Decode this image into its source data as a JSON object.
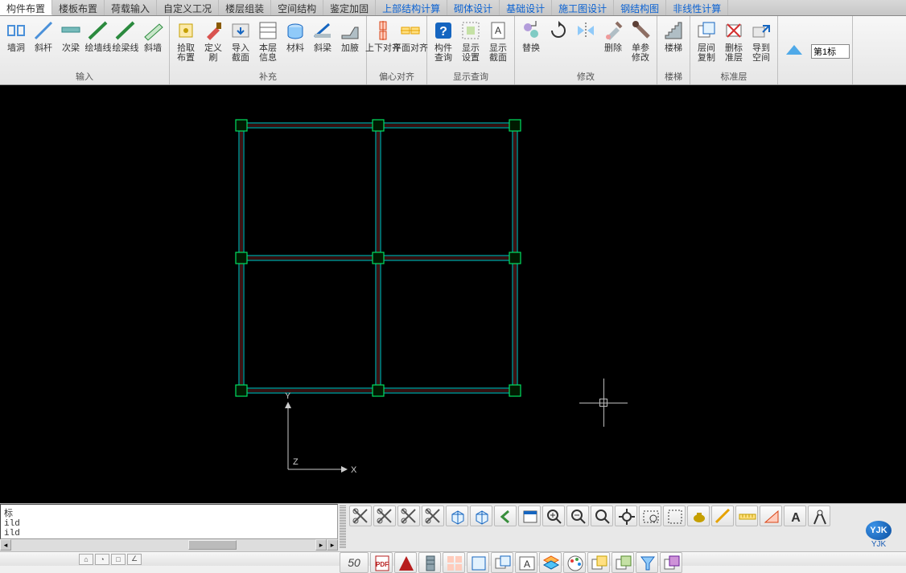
{
  "tabs": [
    {
      "label": "构件布置",
      "active": true,
      "blue": false
    },
    {
      "label": "楼板布置",
      "active": false,
      "blue": false
    },
    {
      "label": "荷载输入",
      "active": false,
      "blue": false
    },
    {
      "label": "自定义工况",
      "active": false,
      "blue": false
    },
    {
      "label": "楼层组装",
      "active": false,
      "blue": false
    },
    {
      "label": "空间结构",
      "active": false,
      "blue": false
    },
    {
      "label": "鉴定加固",
      "active": false,
      "blue": false
    },
    {
      "label": "上部结构计算",
      "active": false,
      "blue": true
    },
    {
      "label": "砌体设计",
      "active": false,
      "blue": true
    },
    {
      "label": "基础设计",
      "active": false,
      "blue": true
    },
    {
      "label": "施工图设计",
      "active": false,
      "blue": true
    },
    {
      "label": "钢结构图",
      "active": false,
      "blue": true
    },
    {
      "label": "非线性计算",
      "active": false,
      "blue": true
    }
  ],
  "groups": [
    {
      "label": "输入",
      "tools": [
        {
          "l1": "墙洞",
          "l2": "",
          "icon": "wall-gap"
        },
        {
          "l1": "斜杆",
          "l2": "",
          "icon": "diag"
        },
        {
          "l1": "次梁",
          "l2": "",
          "icon": "beam2"
        },
        {
          "l1": "绘墙线",
          "l2": "",
          "icon": "wall-line"
        },
        {
          "l1": "绘梁线",
          "l2": "",
          "icon": "beam-line"
        },
        {
          "l1": "斜墙",
          "l2": "",
          "icon": "diag-wall"
        }
      ]
    },
    {
      "label": "补充",
      "tools": [
        {
          "l1": "拾取",
          "l2": "布置",
          "icon": "pick"
        },
        {
          "l1": "定义",
          "l2": "刷",
          "icon": "brush"
        },
        {
          "l1": "导入",
          "l2": "截面",
          "icon": "import"
        },
        {
          "l1": "本层",
          "l2": "信息",
          "icon": "layer"
        },
        {
          "l1": "材料",
          "l2": "",
          "icon": "material"
        },
        {
          "l1": "斜梁",
          "l2": "",
          "icon": "diag-beam"
        },
        {
          "l1": "加腋",
          "l2": "",
          "icon": "haunch"
        }
      ]
    },
    {
      "label": "偏心对齐",
      "tools": [
        {
          "l1": "上下对齐",
          "l2": "",
          "icon": "align-v"
        },
        {
          "l1": "平面对齐",
          "l2": "",
          "icon": "align-h"
        }
      ]
    },
    {
      "label": "显示查询",
      "tools": [
        {
          "l1": "构件",
          "l2": "查询",
          "icon": "query"
        },
        {
          "l1": "显示",
          "l2": "设置",
          "icon": "disp-set"
        },
        {
          "l1": "显示",
          "l2": "截面",
          "icon": "disp-sec"
        }
      ]
    },
    {
      "label": "修改",
      "tools": [
        {
          "l1": "替换",
          "l2": "",
          "icon": "replace"
        },
        {
          "l1": "",
          "l2": "",
          "icon": "rotate"
        },
        {
          "l1": "",
          "l2": "",
          "icon": "mirror"
        },
        {
          "l1": "删除",
          "l2": "",
          "icon": "delete"
        },
        {
          "l1": "单参",
          "l2": "修改",
          "icon": "param"
        }
      ]
    },
    {
      "label": "楼梯",
      "tools": [
        {
          "l1": "楼梯",
          "l2": "",
          "icon": "stair"
        }
      ]
    },
    {
      "label": "标准层",
      "tools": [
        {
          "l1": "层间",
          "l2": "复制",
          "icon": "copy"
        },
        {
          "l1": "删标",
          "l2": "准层",
          "icon": "del-layer"
        },
        {
          "l1": "导到",
          "l2": "空间",
          "icon": "export"
        }
      ]
    }
  ],
  "dropdown_value": "第1标",
  "axis": {
    "x": "X",
    "y": "Y",
    "z": "Z"
  },
  "cmd_lines": "标\nild\nild",
  "bottom_number": "50",
  "logo_text": "YJK",
  "logo_sub": "YJK",
  "bottom_icons": [
    "scissors-1",
    "scissors-2",
    "scissors-3",
    "scissors-4",
    "cube-1",
    "cube-2",
    "back",
    "window",
    "zoom-in",
    "zoom-out",
    "zoom-fit",
    "pan",
    "zoom-win",
    "select-box",
    "teapot",
    "measure",
    "ruler",
    "triangle",
    "text-a",
    "compass"
  ],
  "bottom_icons2": [
    "pdf",
    "acad",
    "building",
    "grid-copy",
    "sel-1",
    "sel-2",
    "text-box",
    "layers",
    "palette",
    "copy-1",
    "copy-2",
    "filter",
    "copy-3"
  ]
}
